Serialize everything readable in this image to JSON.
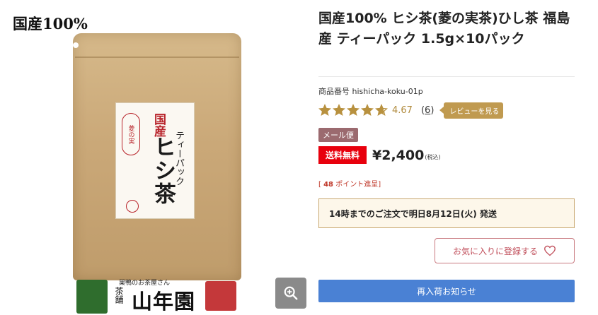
{
  "image": {
    "badge": "国産100%",
    "package": {
      "kokusan": "国産",
      "product_name": "ヒシ茶",
      "tea_bag": "ティーパック",
      "seal": "菱の実"
    },
    "shop": {
      "tagline": "巣鴨のお茶屋さん",
      "ho": "茶舗",
      "name": "山年園"
    },
    "zoom_icon": "magnifier-plus-icon"
  },
  "product": {
    "title": "国産100% ヒシ茶(菱の実茶)ひし茶 福島産 ティーパック 1.5g×10パック",
    "sku_label": "商品番号",
    "sku": "hishicha-koku-01p",
    "rating": {
      "value": 4.67,
      "value_text": "4.67",
      "count_text": "6",
      "review_button": "レビューを見る",
      "star_color": "#b8913f"
    },
    "mail_badge": "メール便",
    "free_shipping": "送料無料",
    "price": "¥2,400",
    "tax": "(税込)",
    "points_prefix": "[",
    "points_value": "48",
    "points_suffix": "ポイント進呈]",
    "shipping_notice": "14時までのご注文で明日8月12日(火) 発送",
    "favorite_button": "お気に入りに登録する",
    "restock_button": "再入荷お知らせ"
  }
}
